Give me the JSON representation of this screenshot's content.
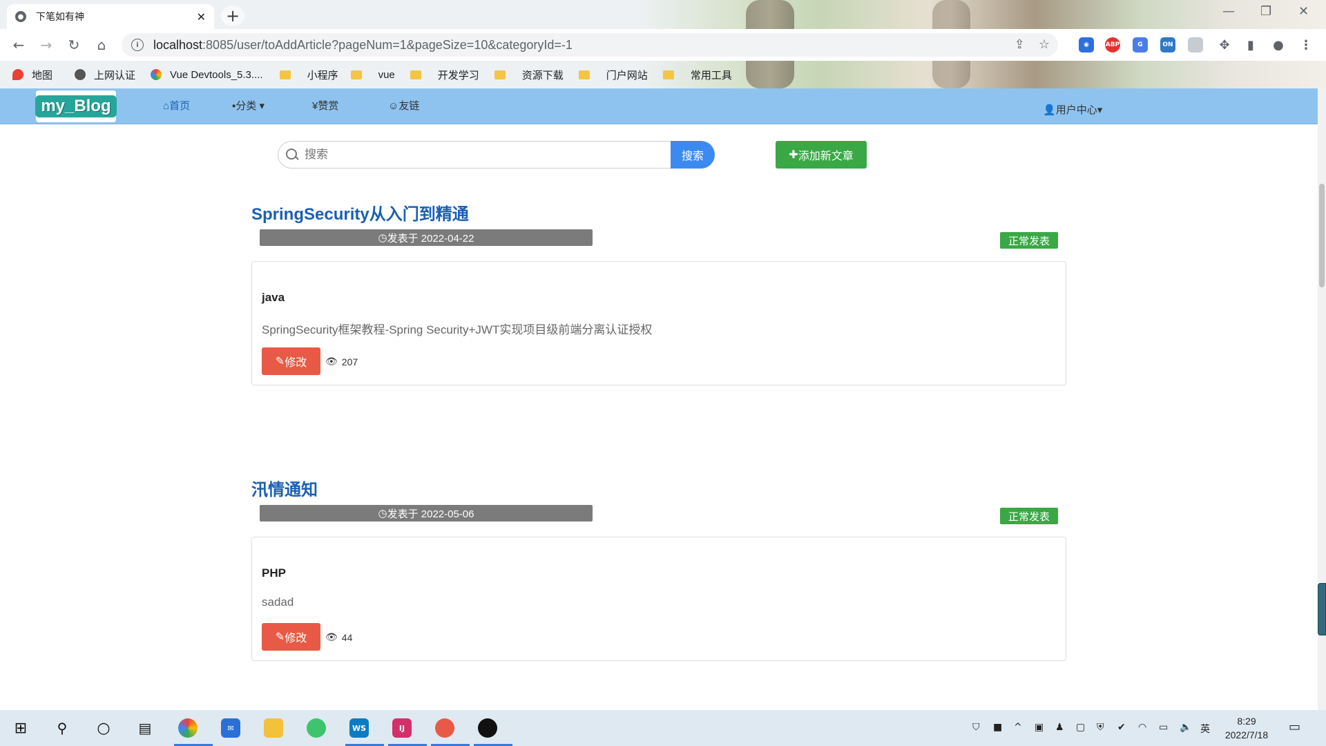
{
  "browser": {
    "tab_title": "下笔如有神",
    "url_host": "localhost",
    "url_rest": ":8085/user/toAddArticle?pageNum=1&pageSize=10&categoryId=-1",
    "bookmarks": [
      "地图",
      "上网认证",
      "Vue Devtools_5.3....",
      "小程序",
      "vue",
      "开发学习",
      "资源下载",
      "门户网站",
      "常用工具"
    ]
  },
  "navbar": {
    "logo": "my_Blog",
    "items": [
      "首页",
      "分类",
      "赞赏",
      "友链"
    ],
    "user_center": "用户中心"
  },
  "search": {
    "placeholder": "搜索",
    "button": "搜索"
  },
  "add_article_label": "添加新文章",
  "articles": [
    {
      "title": "SpringSecurity从入门到精通",
      "date_label": "发表于 2022-04-22",
      "status": "正常发表",
      "category": "java",
      "summary": "SpringSecurity框架教程-Spring Security+JWT实现项目级前端分离认证授权",
      "edit_label": "修改",
      "views": "207"
    },
    {
      "title": "汛情通知",
      "date_label": "发表于 2022-05-06",
      "status": "正常发表",
      "category": "PHP",
      "summary": "sadad",
      "edit_label": "修改",
      "views": "44"
    }
  ],
  "taskbar": {
    "time": "8:29",
    "date": "2022/7/18",
    "ime": "英"
  },
  "colors": {
    "navbar": "#8ec3f0",
    "primary_link": "#1a5fb4",
    "success": "#3aa845",
    "danger": "#e85a45",
    "search_btn": "#3b8af2"
  }
}
